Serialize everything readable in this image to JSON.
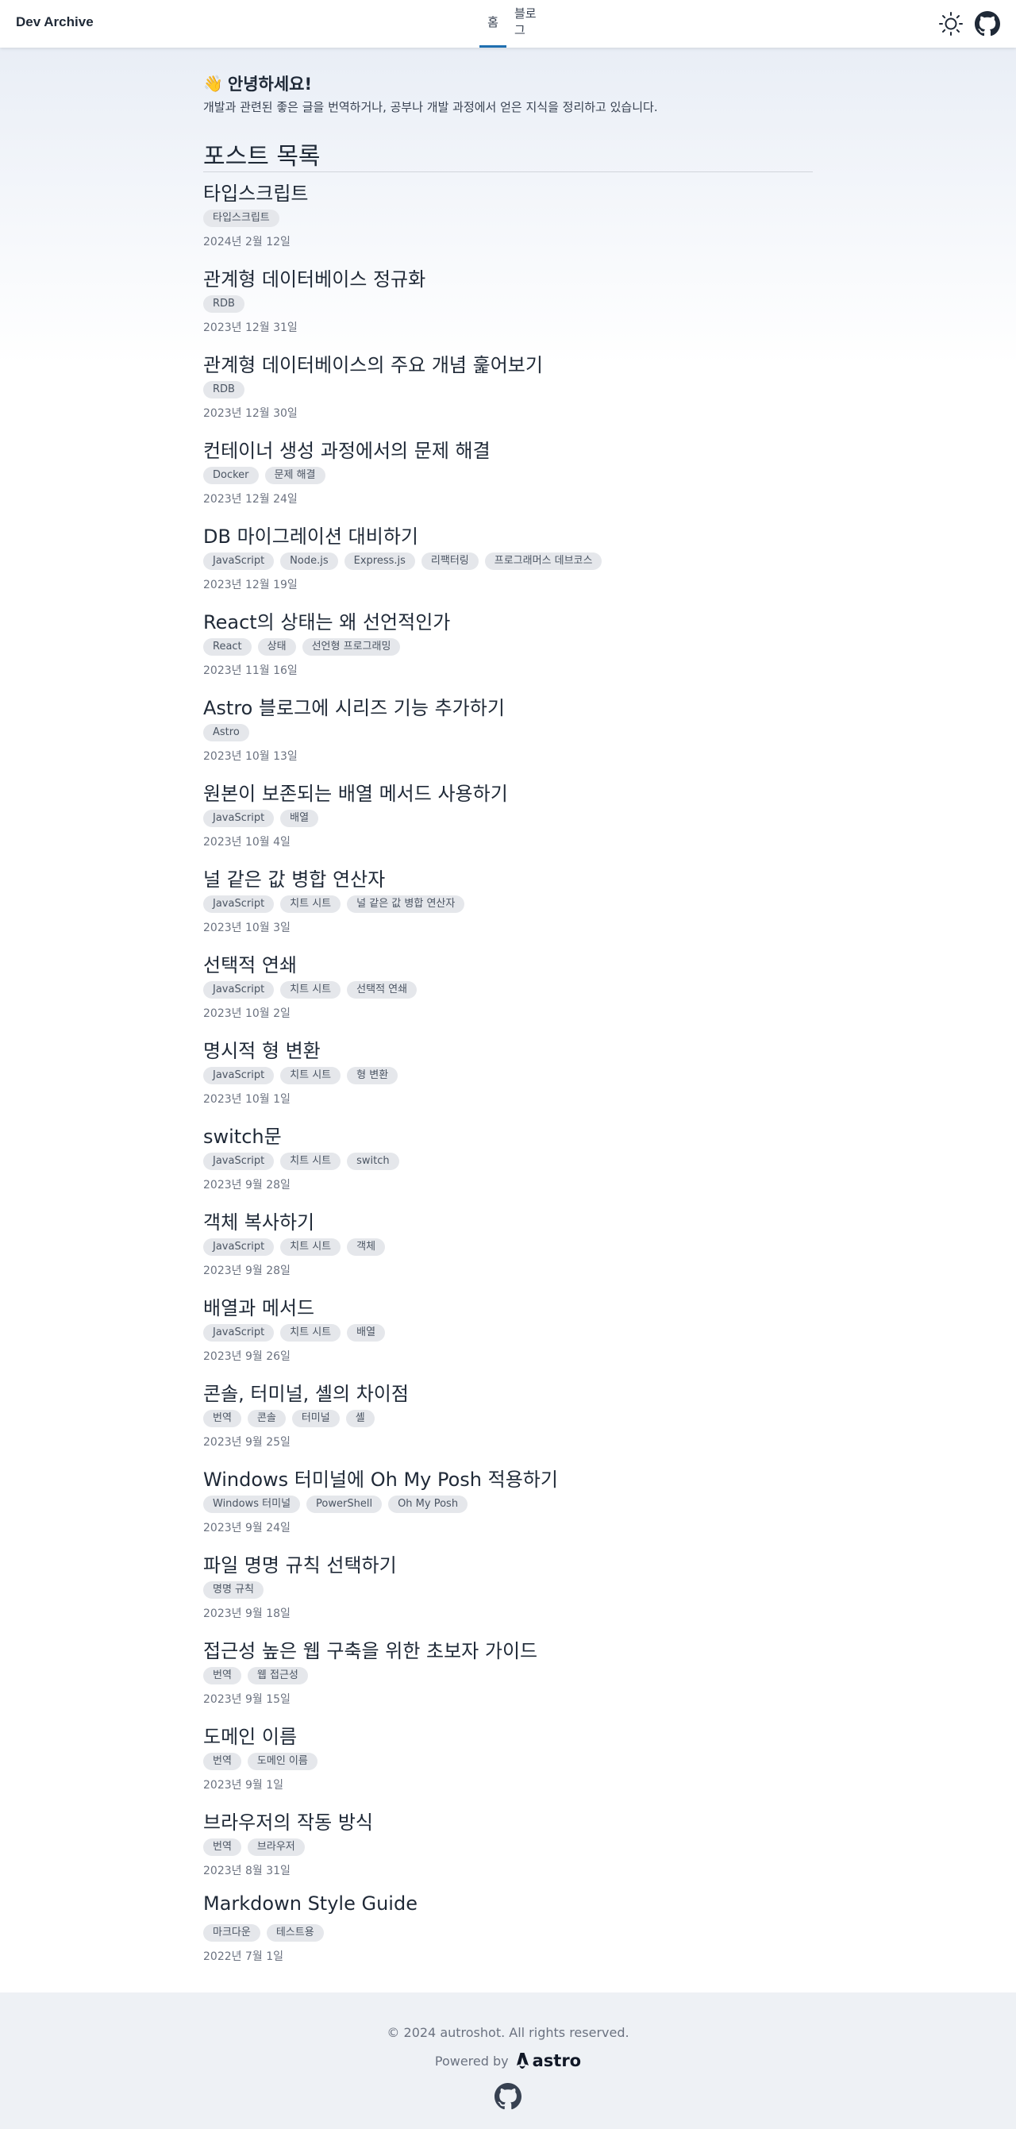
{
  "header": {
    "brand": "Dev Archive",
    "nav": [
      {
        "label": "홈",
        "active": true
      },
      {
        "label": "블로그",
        "active": false
      }
    ],
    "icons": [
      "sun-icon",
      "github-icon"
    ]
  },
  "intro": {
    "title": "안녕하세요!",
    "emoji": "👋",
    "description": "개발과 관련된 좋은 글을 번역하거나, 공부나 개발 과정에서 얻은 지식을 정리하고 있습니다."
  },
  "section_title": "포스트 목록",
  "posts": [
    {
      "title": "타입스크립트",
      "tags": [
        "타입스크립트"
      ],
      "date": "2024년 2월 12일"
    },
    {
      "title": "관계형 데이터베이스 정규화",
      "tags": [
        "RDB"
      ],
      "date": "2023년 12월 31일"
    },
    {
      "title": "관계형 데이터베이스의 주요 개념 훑어보기",
      "tags": [
        "RDB"
      ],
      "date": "2023년 12월 30일"
    },
    {
      "title": "컨테이너 생성 과정에서의 문제 해결",
      "tags": [
        "Docker",
        "문제 해결"
      ],
      "date": "2023년 12월 24일"
    },
    {
      "title": "DB 마이그레이션 대비하기",
      "tags": [
        "JavaScript",
        "Node.js",
        "Express.js",
        "리팩터링",
        "프로그래머스 데브코스"
      ],
      "date": "2023년 12월 19일"
    },
    {
      "title": "React의 상태는 왜 선언적인가",
      "tags": [
        "React",
        "상태",
        "선언형 프로그래밍"
      ],
      "date": "2023년 11월 16일"
    },
    {
      "title": "Astro 블로그에 시리즈 기능 추가하기",
      "tags": [
        "Astro"
      ],
      "date": "2023년 10월 13일"
    },
    {
      "title": "원본이 보존되는 배열 메서드 사용하기",
      "tags": [
        "JavaScript",
        "배열"
      ],
      "date": "2023년 10월 4일"
    },
    {
      "title": "널 같은 값 병합 연산자",
      "tags": [
        "JavaScript",
        "치트 시트",
        "널 같은 값 병합 연산자"
      ],
      "date": "2023년 10월 3일"
    },
    {
      "title": "선택적 연쇄",
      "tags": [
        "JavaScript",
        "치트 시트",
        "선택적 연쇄"
      ],
      "date": "2023년 10월 2일"
    },
    {
      "title": "명시적 형 변환",
      "tags": [
        "JavaScript",
        "치트 시트",
        "형 변환"
      ],
      "date": "2023년 10월 1일"
    },
    {
      "title": "switch문",
      "tags": [
        "JavaScript",
        "치트 시트",
        "switch"
      ],
      "date": "2023년 9월 28일"
    },
    {
      "title": "객체 복사하기",
      "tags": [
        "JavaScript",
        "치트 시트",
        "객체"
      ],
      "date": "2023년 9월 28일"
    },
    {
      "title": "배열과 메서드",
      "tags": [
        "JavaScript",
        "치트 시트",
        "배열"
      ],
      "date": "2023년 9월 26일"
    },
    {
      "title": "콘솔, 터미널, 셸의 차이점",
      "tags": [
        "번역",
        "콘솔",
        "터미널",
        "셸"
      ],
      "date": "2023년 9월 25일"
    },
    {
      "title": "Windows 터미널에 Oh My Posh 적용하기",
      "tags": [
        "Windows 터미널",
        "PowerShell",
        "Oh My Posh"
      ],
      "date": "2023년 9월 24일"
    },
    {
      "title": "파일 명명 규칙 선택하기",
      "tags": [
        "명명 규칙"
      ],
      "date": "2023년 9월 18일"
    },
    {
      "title": "접근성 높은 웹 구축을 위한 초보자 가이드",
      "tags": [
        "번역",
        "웹 접근성"
      ],
      "date": "2023년 9월 15일"
    },
    {
      "title": "도메인 이름",
      "tags": [
        "번역",
        "도메인 이름"
      ],
      "date": "2023년 9월 1일"
    },
    {
      "title": "브라우저의 작동 방식",
      "tags": [
        "번역",
        "브라우저"
      ],
      "date": "2023년 8월 31일"
    },
    {
      "title": "Markdown Style Guide",
      "tags": [
        "마크다운",
        "테스트용"
      ],
      "date": "2022년 7월 1일"
    }
  ],
  "footer": {
    "copyright": "© 2024 autroshot. All rights reserved.",
    "powered_by": "Powered by",
    "astro_wordmark": "astro",
    "icons": [
      "astro-logo-icon",
      "github-icon"
    ]
  },
  "colors": {
    "accent": "#1f6fb0",
    "tag_bg": "#e5e7eb",
    "footer_bg": "#eef1f5"
  }
}
